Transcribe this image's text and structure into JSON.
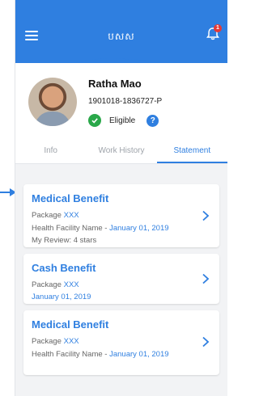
{
  "header": {
    "title": "បសស",
    "notification_count": "1"
  },
  "profile": {
    "name": "Ratha Mao",
    "id": "1901018-1836727-P",
    "status": "Eligible",
    "help_label": "?"
  },
  "tabs": [
    {
      "label": "Info",
      "active": false
    },
    {
      "label": "Work History",
      "active": false
    },
    {
      "label": "Statement",
      "active": true
    }
  ],
  "cards": [
    {
      "title": "Medical Benefit",
      "package_label": "Package",
      "package_value": "XXX",
      "facility": "Health Facility Name",
      "separator": " - ",
      "date": "January 01, 2019",
      "review": "My Review: 4 stars"
    },
    {
      "title": "Cash Benefit",
      "package_label": "Package",
      "package_value": "XXX",
      "date": "January 01, 2019"
    },
    {
      "title": "Medical Benefit",
      "package_label": "Package",
      "package_value": "XXX",
      "facility": "Health Facility Name",
      "separator": " - ",
      "date": "January 01, 2019"
    }
  ],
  "colors": {
    "primary": "#2f7fe0",
    "success": "#2aa84a",
    "badge": "#e53935"
  }
}
